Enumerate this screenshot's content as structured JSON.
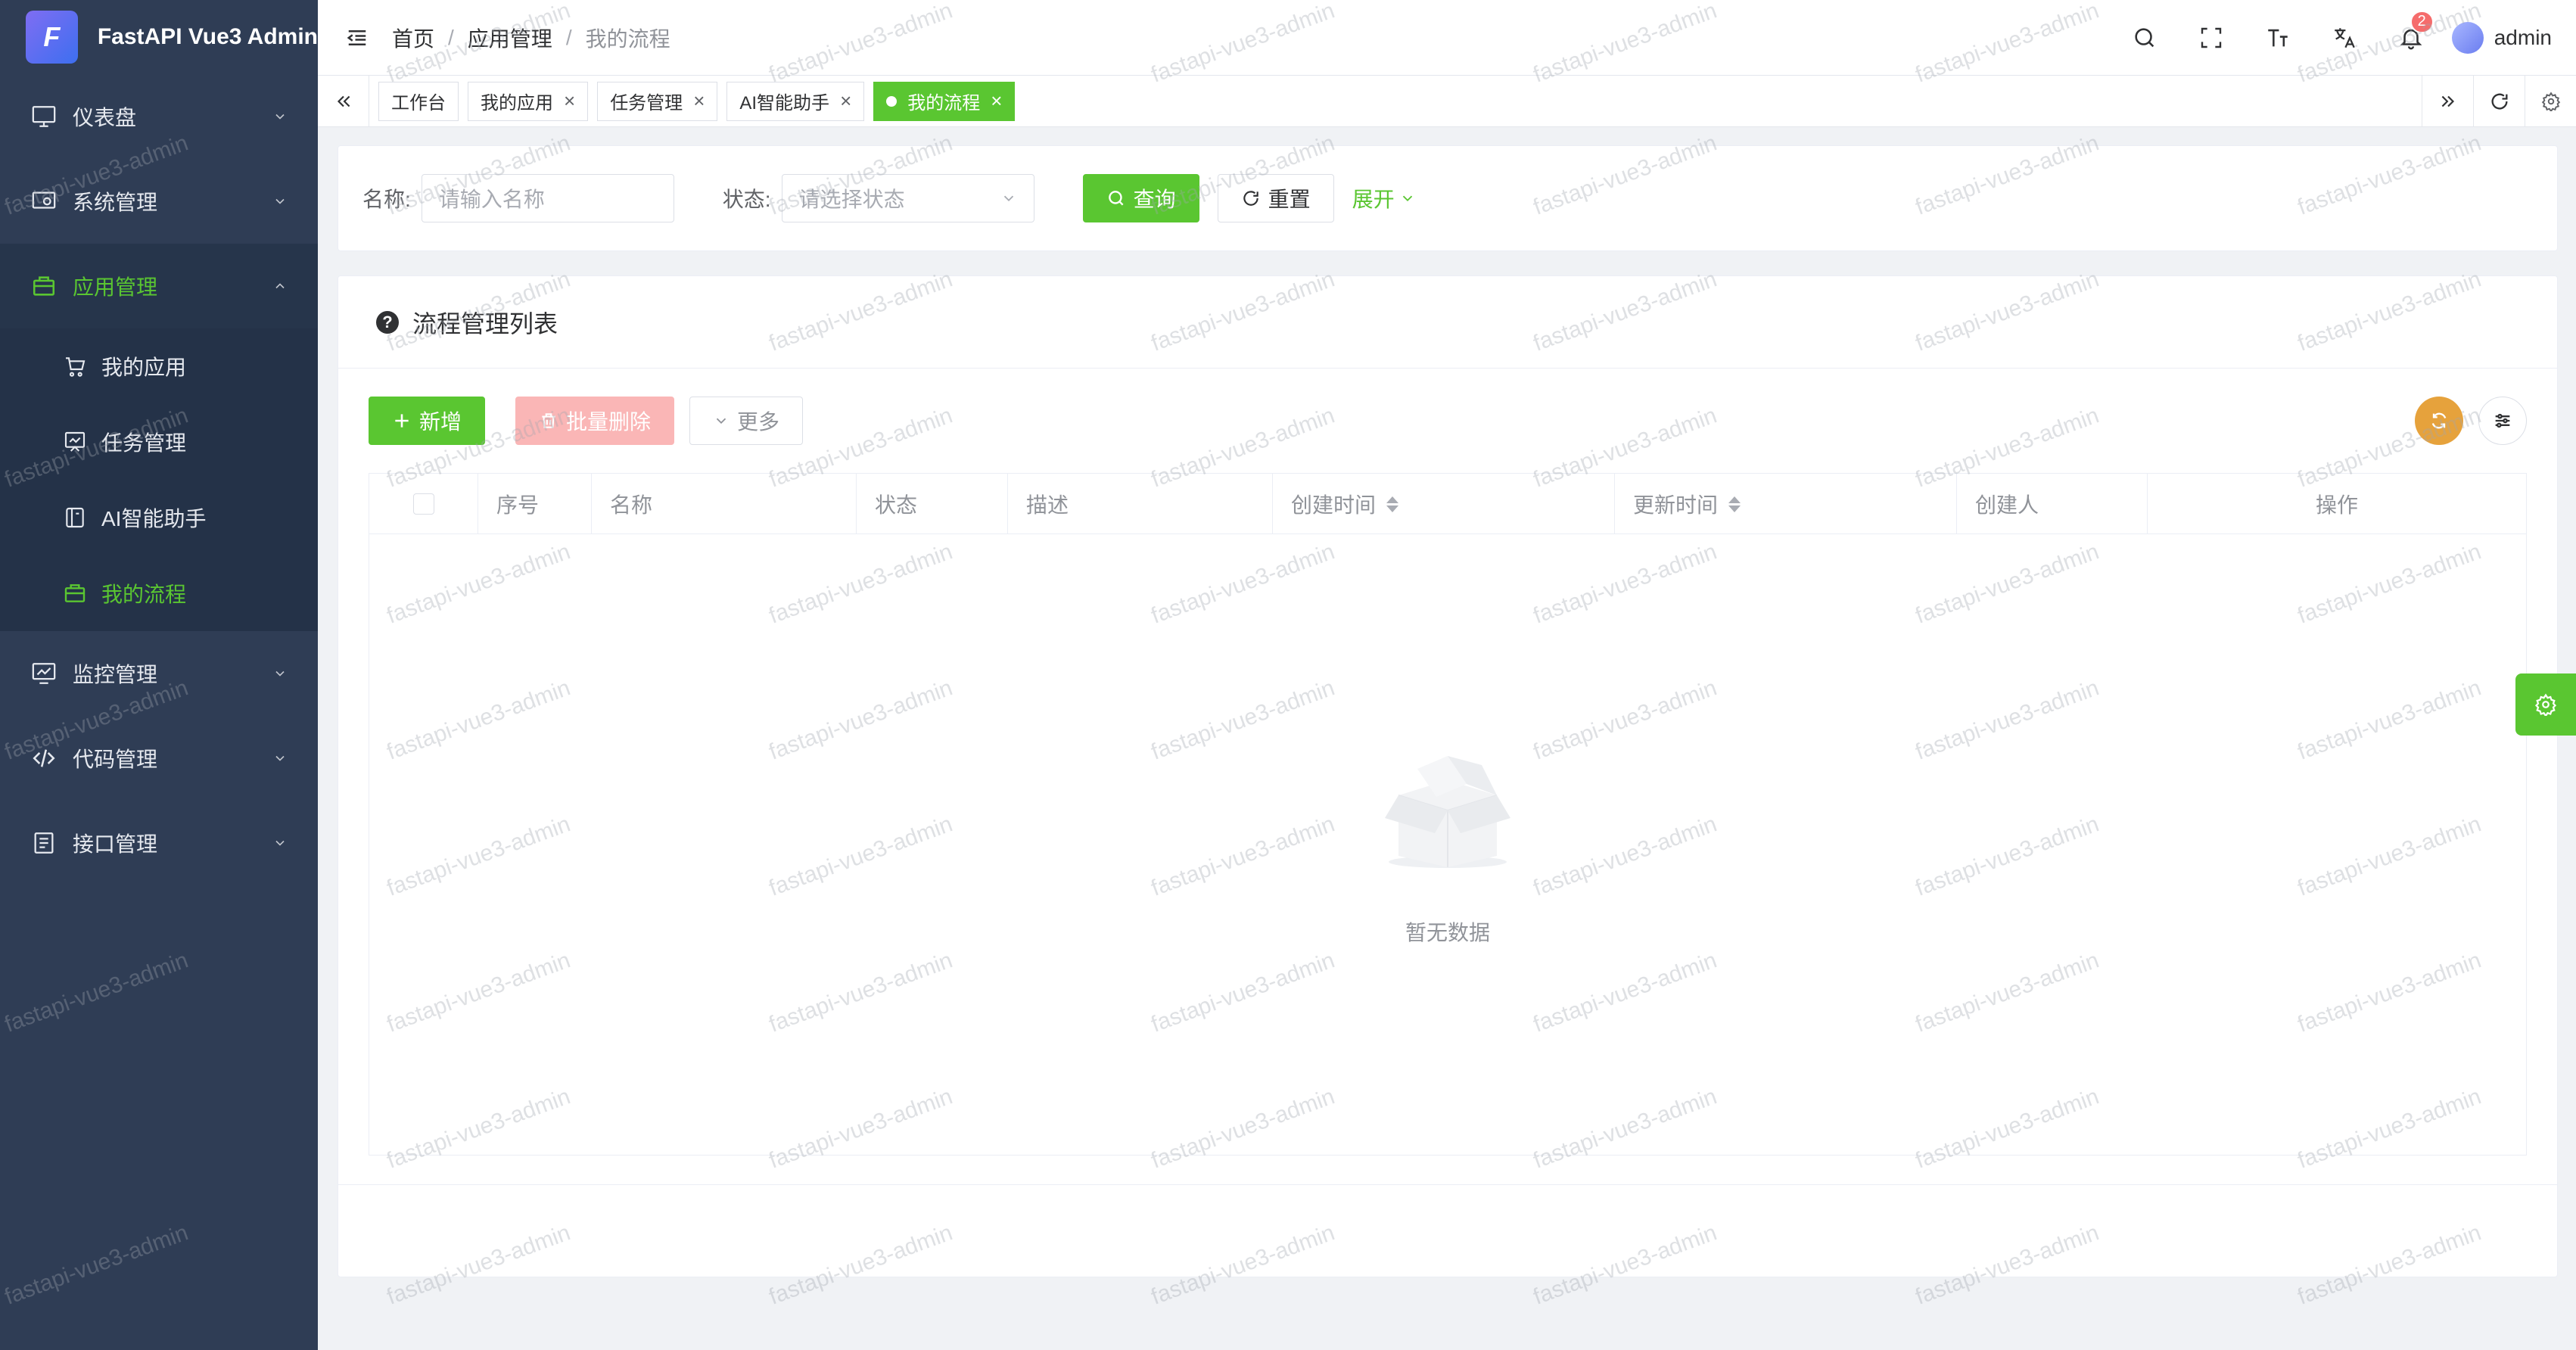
{
  "app": {
    "title": "FastAPI Vue3 Admin",
    "logo_text": "F"
  },
  "sidebar": {
    "items": [
      {
        "label": "仪表盘",
        "icon": "monitor-icon"
      },
      {
        "label": "系统管理",
        "icon": "system-settings-icon"
      },
      {
        "label": "应用管理",
        "icon": "briefcase-icon",
        "expanded": true,
        "children": [
          {
            "label": "我的应用",
            "icon": "cart-icon"
          },
          {
            "label": "任务管理",
            "icon": "task-board-icon"
          },
          {
            "label": "AI智能助手",
            "icon": "ai-assistant-icon"
          },
          {
            "label": "我的流程",
            "icon": "briefcase-icon",
            "current": true
          }
        ]
      },
      {
        "label": "监控管理",
        "icon": "monitor-chart-icon"
      },
      {
        "label": "代码管理",
        "icon": "code-icon"
      },
      {
        "label": "接口管理",
        "icon": "document-icon"
      }
    ]
  },
  "header": {
    "breadcrumb": [
      "首页",
      "应用管理",
      "我的流程"
    ],
    "notification_count": "2",
    "username": "admin"
  },
  "tags": [
    {
      "label": "工作台",
      "closable": false,
      "active": false
    },
    {
      "label": "我的应用",
      "closable": true,
      "active": false
    },
    {
      "label": "任务管理",
      "closable": true,
      "active": false
    },
    {
      "label": "AI智能助手",
      "closable": true,
      "active": false
    },
    {
      "label": "我的流程",
      "closable": true,
      "active": true
    }
  ],
  "search": {
    "name_label": "名称:",
    "name_placeholder": "请输入名称",
    "status_label": "状态:",
    "status_placeholder": "请选择状态",
    "query_label": "查询",
    "reset_label": "重置",
    "expand_label": "展开"
  },
  "card": {
    "title": "流程管理列表",
    "add_label": "新增",
    "batch_delete_label": "批量删除",
    "more_label": "更多"
  },
  "table": {
    "columns": [
      "序号",
      "名称",
      "状态",
      "描述",
      "创建时间",
      "更新时间",
      "创建人",
      "操作"
    ],
    "empty_text": "暂无数据"
  },
  "watermark": "fastapi-vue3-admin",
  "colors": {
    "primary": "#5ac631",
    "sidebar_bg": "#2f3d55",
    "warning": "#e6a23c",
    "danger_light": "#fab6b6"
  }
}
